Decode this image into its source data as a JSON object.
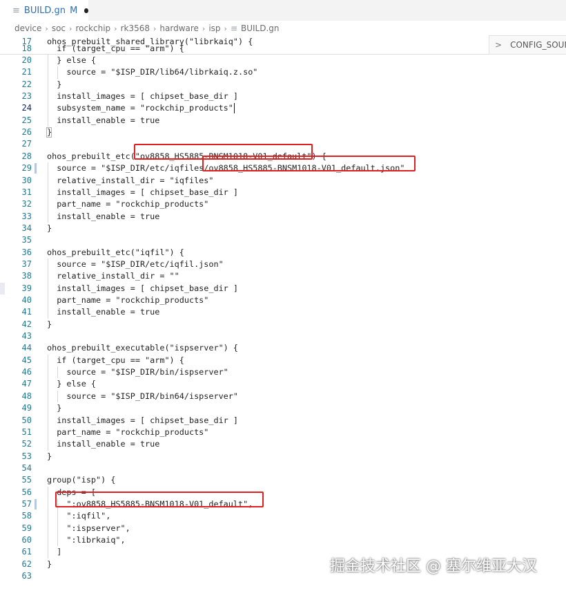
{
  "tab": {
    "file_name": "BUILD.gn",
    "status": "M",
    "icon": "file-lines-icon"
  },
  "breadcrumb": [
    "device",
    "soc",
    "rockchip",
    "rk3568",
    "hardware",
    "isp",
    "BUILD.gn"
  ],
  "outline": {
    "label": "CONFIG_SOUND"
  },
  "sticky_line": {
    "number": "17",
    "text": "ohos_prebuilt_shared_library(\"librkaiq\") {"
  },
  "lines": [
    {
      "n": "18",
      "text": "  if (target_cpu == \"arm\") {"
    },
    {
      "n": "20",
      "text": "  } else {"
    },
    {
      "n": "21",
      "text": "    source = \"$ISP_DIR/lib64/librkaiq.z.so\""
    },
    {
      "n": "22",
      "text": "  }"
    },
    {
      "n": "23",
      "text": "  install_images = [ chipset_base_dir ]"
    },
    {
      "n": "24",
      "text": "  subsystem_name = \"rockchip_products\""
    },
    {
      "n": "25",
      "text": "  install_enable = true"
    },
    {
      "n": "26",
      "text": "}"
    },
    {
      "n": "27",
      "text": ""
    },
    {
      "n": "28",
      "text": "ohos_prebuilt_etc(\"ov8858_HS5885-BNSM1018-V01_default\") {"
    },
    {
      "n": "29",
      "text": "  source = \"$ISP_DIR/etc/iqfiles/ov8858_HS5885-BNSM1018-V01_default.json\""
    },
    {
      "n": "30",
      "text": "  relative_install_dir = \"iqfiles\""
    },
    {
      "n": "31",
      "text": "  install_images = [ chipset_base_dir ]"
    },
    {
      "n": "32",
      "text": "  part_name = \"rockchip_products\""
    },
    {
      "n": "33",
      "text": "  install_enable = true"
    },
    {
      "n": "34",
      "text": "}"
    },
    {
      "n": "35",
      "text": ""
    },
    {
      "n": "36",
      "text": "ohos_prebuilt_etc(\"iqfil\") {"
    },
    {
      "n": "37",
      "text": "  source = \"$ISP_DIR/etc/iqfil.json\""
    },
    {
      "n": "38",
      "text": "  relative_install_dir = \"\""
    },
    {
      "n": "39",
      "text": "  install_images = [ chipset_base_dir ]"
    },
    {
      "n": "40",
      "text": "  part_name = \"rockchip_products\""
    },
    {
      "n": "41",
      "text": "  install_enable = true"
    },
    {
      "n": "42",
      "text": "}"
    },
    {
      "n": "43",
      "text": ""
    },
    {
      "n": "44",
      "text": "ohos_prebuilt_executable(\"ispserver\") {"
    },
    {
      "n": "45",
      "text": "  if (target_cpu == \"arm\") {"
    },
    {
      "n": "46",
      "text": "    source = \"$ISP_DIR/bin/ispserver\""
    },
    {
      "n": "47",
      "text": "  } else {"
    },
    {
      "n": "48",
      "text": "    source = \"$ISP_DIR/bin64/ispserver\""
    },
    {
      "n": "49",
      "text": "  }"
    },
    {
      "n": "50",
      "text": "  install_images = [ chipset_base_dir ]"
    },
    {
      "n": "51",
      "text": "  part_name = \"rockchip_products\""
    },
    {
      "n": "52",
      "text": "  install_enable = true"
    },
    {
      "n": "53",
      "text": "}"
    },
    {
      "n": "54",
      "text": ""
    },
    {
      "n": "55",
      "text": "group(\"isp\") {"
    },
    {
      "n": "56",
      "text": "  deps = ["
    },
    {
      "n": "57",
      "text": "    \":ov8858_HS5885-BNSM1018-V01_default\","
    },
    {
      "n": "58",
      "text": "    \":iqfil\","
    },
    {
      "n": "59",
      "text": "    \":ispserver\","
    },
    {
      "n": "60",
      "text": "    \":librkaiq\","
    },
    {
      "n": "61",
      "text": "  ]"
    },
    {
      "n": "62",
      "text": "}"
    },
    {
      "n": "63",
      "text": ""
    }
  ],
  "watermark": "掘金技术社区 @ 塞尔维亚大汉",
  "colors": {
    "highlight_box": "#e02020",
    "line_number": "#237893",
    "tab_text": "#2f6fb0"
  }
}
